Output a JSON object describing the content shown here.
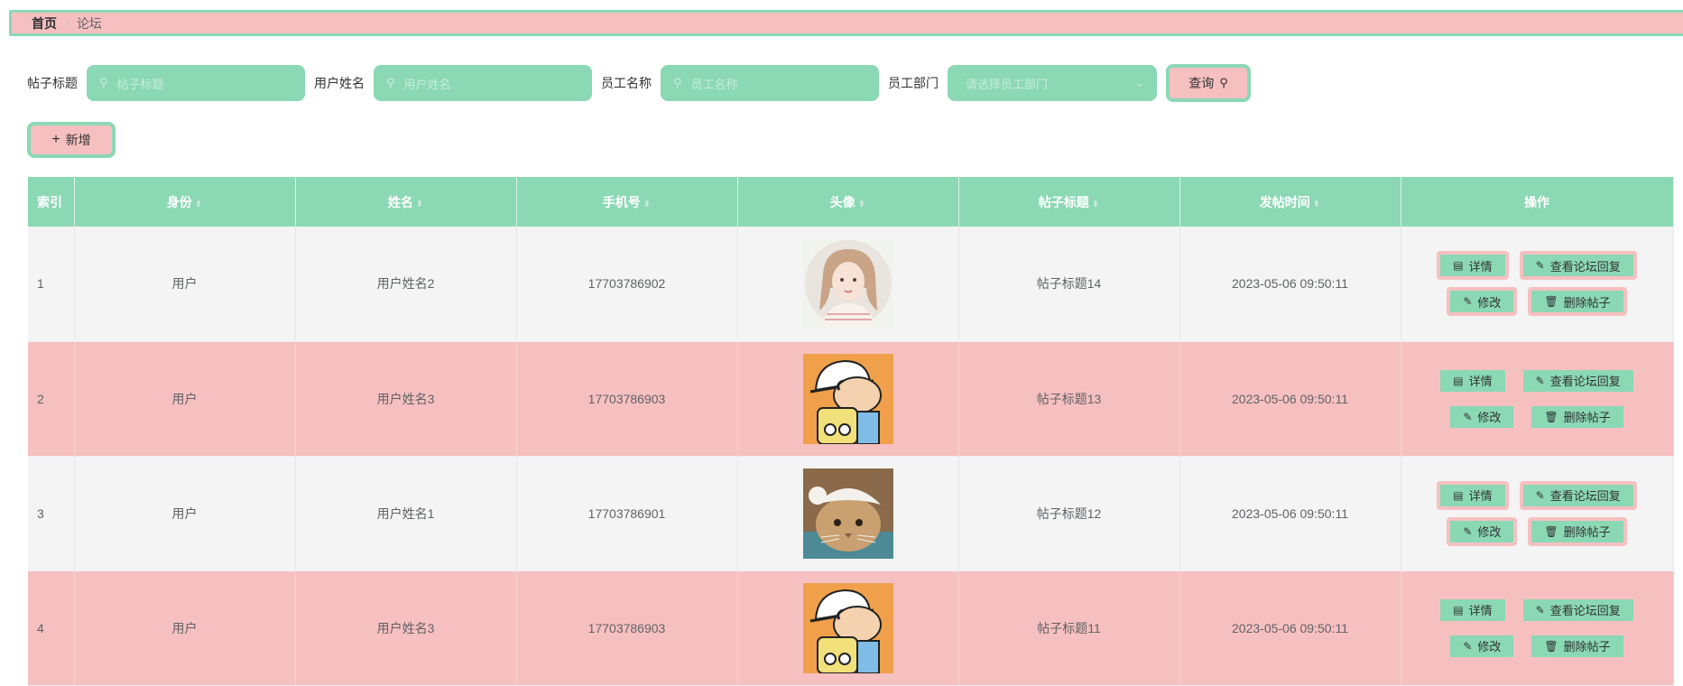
{
  "breadcrumb": {
    "home": "首页",
    "separator": "/",
    "current": "论坛"
  },
  "search": {
    "fields": [
      {
        "label": "帖子标题",
        "placeholder": "帖子标题"
      },
      {
        "label": "用户姓名",
        "placeholder": "用户姓名"
      },
      {
        "label": "员工名称",
        "placeholder": "员工名称"
      }
    ],
    "select": {
      "label": "员工部门",
      "placeholder": "请选择员工部门"
    },
    "query_label": "查询"
  },
  "toolbar": {
    "add_label": "新增"
  },
  "table": {
    "headers": [
      "索引",
      "身份",
      "姓名",
      "手机号",
      "头像",
      "帖子标题",
      "发帖时间",
      "操作"
    ],
    "rows": [
      {
        "index": "1",
        "role": "用户",
        "name": "用户姓名2",
        "phone": "17703786902",
        "avatar": "girl-portrait",
        "title": "帖子标题14",
        "time": "2023-05-06 09:50:11"
      },
      {
        "index": "2",
        "role": "用户",
        "name": "用户姓名3",
        "phone": "17703786903",
        "avatar": "cartoon-boy",
        "title": "帖子标题13",
        "time": "2023-05-06 09:50:11"
      },
      {
        "index": "3",
        "role": "用户",
        "name": "用户姓名1",
        "phone": "17703786901",
        "avatar": "cat-photo",
        "title": "帖子标题12",
        "time": "2023-05-06 09:50:11"
      },
      {
        "index": "4",
        "role": "用户",
        "name": "用户姓名3",
        "phone": "17703786903",
        "avatar": "cartoon-boy",
        "title": "帖子标题11",
        "time": "2023-05-06 09:50:11"
      }
    ],
    "actions": {
      "detail": "详情",
      "replies": "查看论坛回复",
      "edit": "修改",
      "delete": "删除帖子"
    }
  },
  "colors": {
    "green": "#8bd8b5",
    "pink": "#f7c0c0",
    "stripe": "#f4f4f4"
  }
}
